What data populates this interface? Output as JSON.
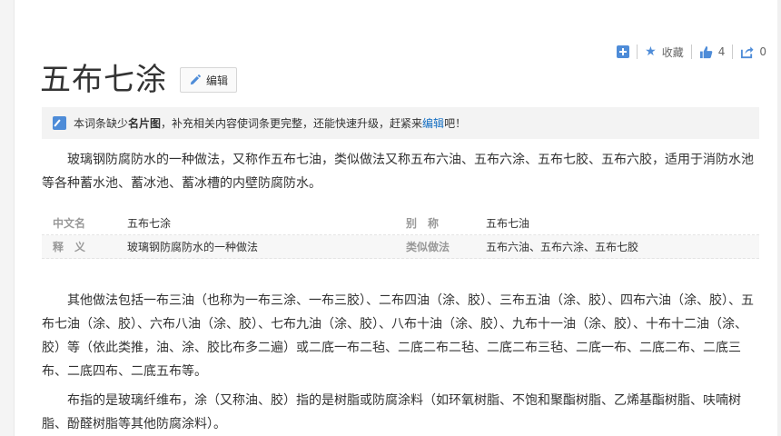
{
  "toolbar": {
    "favorite_label": "收藏",
    "like_count": "4",
    "share_count": "0"
  },
  "title": "五布七涂",
  "edit_label": "编辑",
  "notice": {
    "pre": "本词条缺少",
    "bold": "名片图",
    "mid": "，补充相关内容使词条更完整，还能快速升级，赶紧来",
    "link": "编辑",
    "post": "吧！"
  },
  "intro": "玻璃钢防腐防水的一种做法，又称作五布七油，类似做法又称五布六油、五布六涂、五布七胶、五布六胶，适用于消防水池等各种蓄水池、蓄冰池、蓄冰槽的内壁防腐防水。",
  "info": [
    {
      "k1": "中文名",
      "v1": "五布七涂",
      "k2": "别　称",
      "v2": "五布七油"
    },
    {
      "k1": "释　义",
      "v1": "玻璃钢防腐防水的一种做法",
      "k2": "类似做法",
      "v2": "五布六油、五布六涂、五布七胶"
    }
  ],
  "para2": "其他做法包括一布三油（也称为一布三涂、一布三胶）、二布四油（涂、胶）、三布五油（涂、胶）、四布六油（涂、胶）、五布七油（涂、胶）、六布八油（涂、胶）、七布九油（涂、胶）、八布十油（涂、胶）、九布十一油（涂、胶）、十布十二油（涂、胶）等（依此类推，油、涂、胶比布多二遍）或二底一布二毡、二底二布二毡、二底二布三毡、二底一布、二底二布、二底三布、二底四布、二底五布等。",
  "para3": "布指的是玻璃纤维布，涂（又称油、胶）指的是树脂或防腐涂料（如环氧树脂、不饱和聚酯树脂、乙烯基酯树脂、呋喃树脂、酚醛树脂等其他防腐涂料）。",
  "colors": {
    "accent": "#4e8cd8",
    "link": "#136ec2"
  }
}
